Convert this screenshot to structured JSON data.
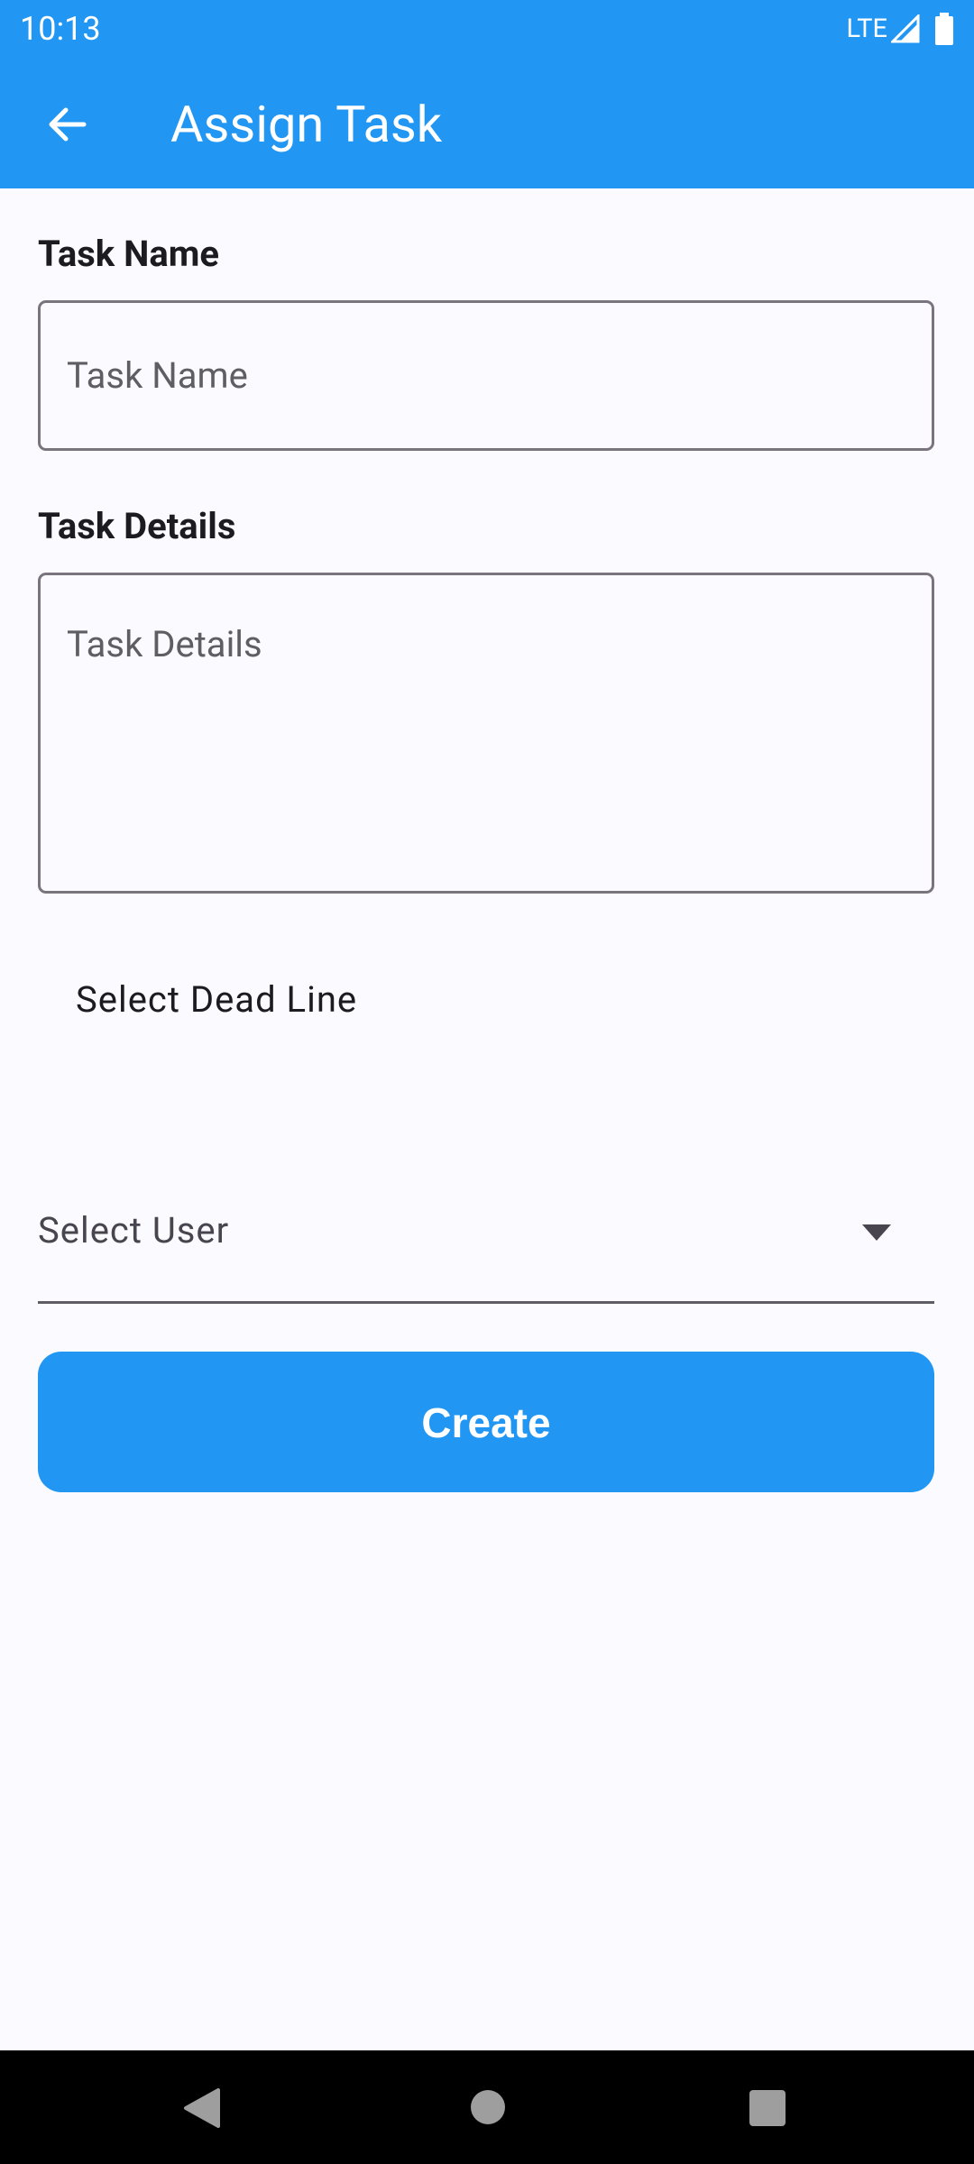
{
  "status_bar": {
    "time": "10:13",
    "network": "LTE"
  },
  "app_bar": {
    "title": "Assign Task",
    "back_icon": "arrow-back-icon"
  },
  "form": {
    "task_name": {
      "label": "Task Name",
      "placeholder": "Task Name",
      "value": ""
    },
    "task_details": {
      "label": "Task Details",
      "placeholder": "Task Details",
      "value": ""
    },
    "deadline": {
      "label": "Select Dead Line"
    },
    "user_select": {
      "placeholder": "Select User",
      "icon": "dropdown-arrow-icon"
    },
    "create_label": "Create"
  },
  "nav_bar": {
    "icons": [
      "nav-back-icon",
      "nav-home-icon",
      "nav-recents-icon"
    ]
  },
  "colors": {
    "primary": "#2196f3",
    "background": "#fbfbff",
    "nav_bar": "#000000"
  }
}
